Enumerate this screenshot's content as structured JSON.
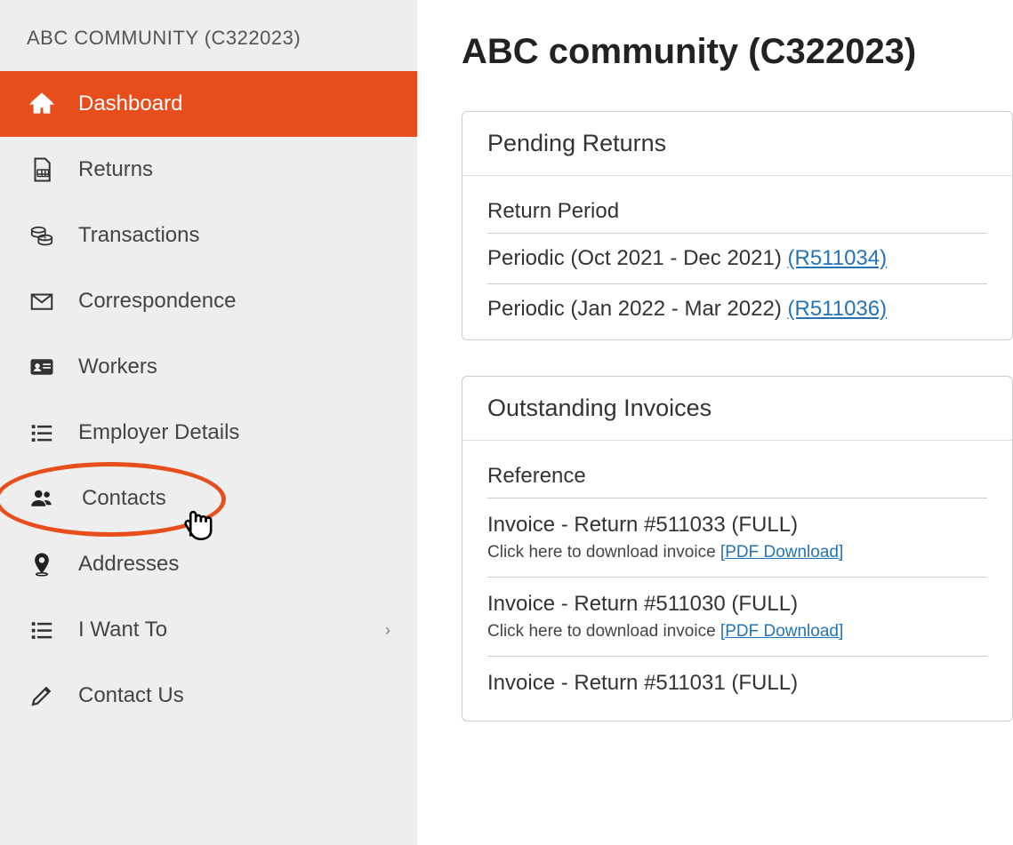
{
  "sidebar": {
    "header": "ABC COMMUNITY (C322023)",
    "items": [
      {
        "label": "Dashboard"
      },
      {
        "label": "Returns"
      },
      {
        "label": "Transactions"
      },
      {
        "label": "Correspondence"
      },
      {
        "label": "Workers"
      },
      {
        "label": "Employer Details"
      },
      {
        "label": "Contacts"
      },
      {
        "label": "Addresses"
      },
      {
        "label": "I Want To"
      },
      {
        "label": "Contact Us"
      }
    ]
  },
  "main": {
    "title": "ABC community (C322023)",
    "pending_returns": {
      "header": "Pending Returns",
      "column": "Return Period",
      "rows": [
        {
          "text": "Periodic (Oct 2021 - Dec 2021) ",
          "link": "(R511034)"
        },
        {
          "text": "Periodic (Jan 2022 - Mar 2022) ",
          "link": "(R511036)"
        }
      ]
    },
    "outstanding_invoices": {
      "header": "Outstanding Invoices",
      "column": "Reference",
      "download_prefix": "Click here to download invoice ",
      "download_link": "[PDF Download]",
      "rows": [
        {
          "title": "Invoice - Return #511033 (FULL)"
        },
        {
          "title": "Invoice - Return #511030 (FULL)"
        },
        {
          "title": "Invoice - Return #511031 (FULL)"
        }
      ]
    }
  }
}
